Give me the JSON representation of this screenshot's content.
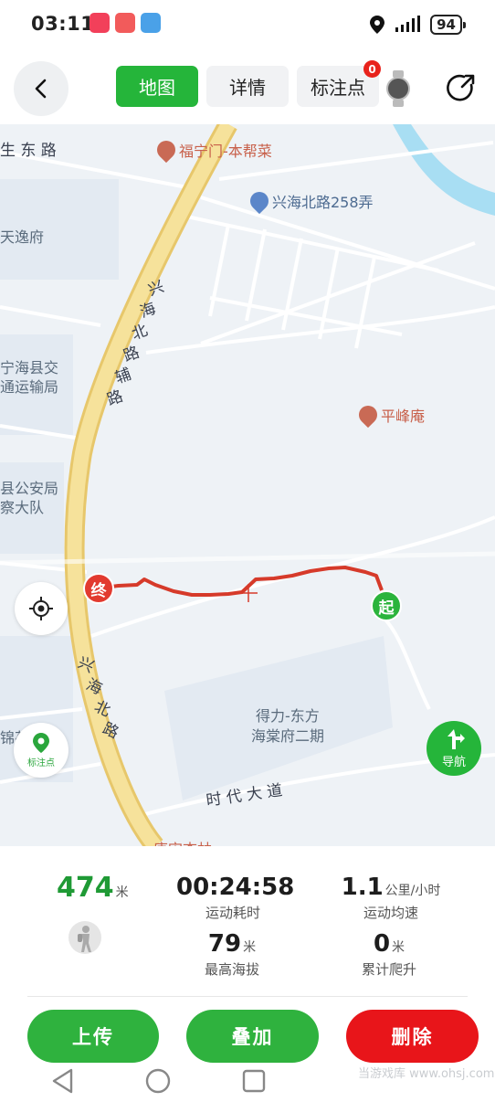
{
  "status_bar": {
    "time": "03:11",
    "battery": "94"
  },
  "header": {
    "tabs": [
      {
        "label": "地图",
        "active": true
      },
      {
        "label": "详情",
        "active": false
      },
      {
        "label": "标注点",
        "active": false,
        "badge": "0"
      }
    ]
  },
  "map": {
    "road_labels": {
      "top_left": "生 东 路",
      "xinghai_bei_fulu": [
        "兴",
        "海",
        "北",
        "路",
        "辅",
        "路"
      ],
      "xinghai_bei_lu": [
        "兴",
        "海",
        "北",
        "路"
      ],
      "shidai_dadao": "时 代 大 道",
      "bottom_cut": "唐宋杏林"
    },
    "area_labels": [
      "天逸府",
      "宁海县交",
      "通运输局",
      "县公安局",
      "察大队",
      "锦苑",
      "得力-东方",
      "海棠府二期"
    ],
    "pois": {
      "futingmen": "福宁门-本帮菜",
      "xinghai258": "兴海北路258弄",
      "pingfengan": "平峰庵"
    },
    "markers": {
      "end": "终",
      "start": "起"
    },
    "buttons": {
      "mark_label": "标注点",
      "nav_label": "导航"
    }
  },
  "stats": {
    "distance": {
      "value": "474",
      "unit": "米"
    },
    "duration": {
      "value": "00:24:58",
      "label": "运动耗时"
    },
    "avg_speed": {
      "value": "1.1",
      "unit": "公里/小时",
      "label": "运动均速"
    },
    "max_altitude": {
      "value": "79",
      "unit": "米",
      "label": "最高海拔"
    },
    "climb": {
      "value": "0",
      "unit": "米",
      "label": "累计爬升"
    }
  },
  "actions": {
    "upload": "上传",
    "overlay": "叠加",
    "delete": "删除"
  },
  "watermark": "当游戏库 www.ohsj.com",
  "colors": {
    "green": "#2fb23e",
    "red": "#e8151a",
    "track": "#d63a2a"
  }
}
